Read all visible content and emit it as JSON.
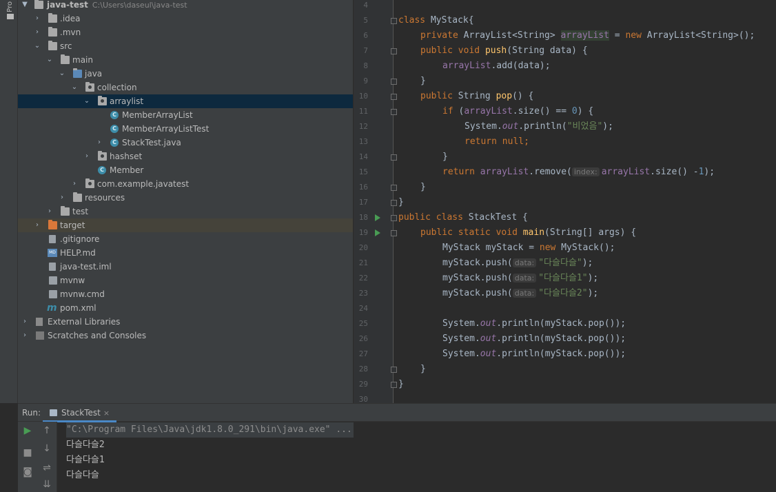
{
  "sidebar_tab": "Pro",
  "project": {
    "root_name": "java-test",
    "root_path": "C:\\Users\\daseul\\java-test",
    "items": [
      {
        "label": ".idea"
      },
      {
        "label": ".mvn"
      },
      {
        "label": "src"
      },
      {
        "label": "main"
      },
      {
        "label": "java"
      },
      {
        "label": "collection"
      },
      {
        "label": "arraylist"
      },
      {
        "label": "MemberArrayList"
      },
      {
        "label": "MemberArrayListTest"
      },
      {
        "label": "StackTest.java"
      },
      {
        "label": "hashset"
      },
      {
        "label": "Member"
      },
      {
        "label": "com.example.javatest"
      },
      {
        "label": "resources"
      },
      {
        "label": "test"
      },
      {
        "label": "target"
      },
      {
        "label": ".gitignore"
      },
      {
        "label": "HELP.md"
      },
      {
        "label": "java-test.iml"
      },
      {
        "label": "mvnw"
      },
      {
        "label": "mvnw.cmd"
      },
      {
        "label": "pom.xml"
      },
      {
        "label": "External Libraries"
      },
      {
        "label": "Scratches and Consoles"
      }
    ]
  },
  "editor": {
    "line_numbers": [
      "4",
      "5",
      "6",
      "7",
      "8",
      "9",
      "10",
      "11",
      "12",
      "13",
      "14",
      "15",
      "16",
      "17",
      "18",
      "19",
      "20",
      "21",
      "22",
      "23",
      "24",
      "25",
      "26",
      "27",
      "28",
      "29",
      "30"
    ],
    "tokens": {
      "class": "class",
      "MyStack": "MyStack{",
      "private": "private",
      "arraylist_type": "ArrayList<String>",
      "arrayList": "arrayList",
      "eq": " = ",
      "new": "new",
      "new_type": "ArrayList<String>();",
      "public": "public",
      "void": "void",
      "push": "push",
      "push_sig": "(String data) {",
      "add_call": ".add(data);",
      "close_brace": "}",
      "String": "String",
      "pop": "pop",
      "pop_sig": "() {",
      "if": "if",
      "if_open": "(",
      "size_eq": ".size() == ",
      "zero": "0",
      "if_close": ") {",
      "System": "System.",
      "out": "out",
      "println_open": ".println(",
      "empty_str": "\"비었음\"",
      "paren_semi": ");",
      "return": "return",
      "null": "null;",
      "remove_call": ".remove(",
      "index_hint": "index:",
      "size_minus": ".size() -",
      "one": "1",
      "close_paren_semi": ");",
      "class_close": "}",
      "class_kw2": "class",
      "StackTest": "StackTest {",
      "static": "static",
      "main": "main",
      "main_sig": "(String[] args) {",
      "mystack_decl": "MyStack myStack = ",
      "mystack_new": "MyStack();",
      "push_call": "myStack.push(",
      "data_hint": "data:",
      "str1": "\"다슬다슬\"",
      "str2": "\"다슬다슬1\"",
      "str3": "\"다슬다슬2\"",
      "print_pop": ".println(myStack.pop());"
    }
  },
  "run": {
    "label": "Run:",
    "tab_name": "StackTest",
    "tab_close": "×",
    "command": "\"C:\\Program Files\\Java\\jdk1.8.0_291\\bin\\java.exe\" ...",
    "output": [
      "다슬다슬2",
      "다슬다슬1",
      "다슬다슬"
    ]
  }
}
